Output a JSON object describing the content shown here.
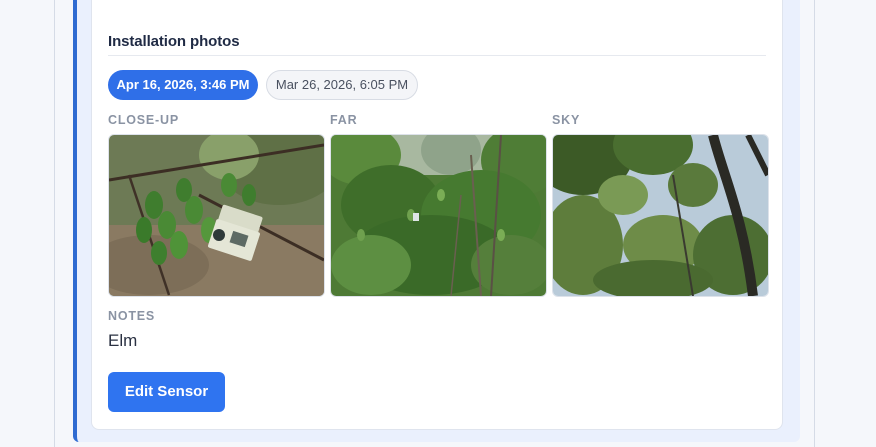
{
  "section": {
    "title": "Installation photos"
  },
  "date_tabs": [
    {
      "label": "Apr 16, 2026, 3:46 PM",
      "selected": true
    },
    {
      "label": "Mar 26, 2026, 6:05 PM",
      "selected": false
    }
  ],
  "photos": [
    {
      "caption": "CLOSE-UP"
    },
    {
      "caption": "FAR"
    },
    {
      "caption": "SKY"
    }
  ],
  "notes": {
    "label": "NOTES",
    "value": "Elm"
  },
  "actions": {
    "edit_label": "Edit Sensor"
  },
  "colors": {
    "accent": "#2f6fe8",
    "panel_border": "#2f6bd1",
    "panel_bg": "#eaf0fd"
  }
}
